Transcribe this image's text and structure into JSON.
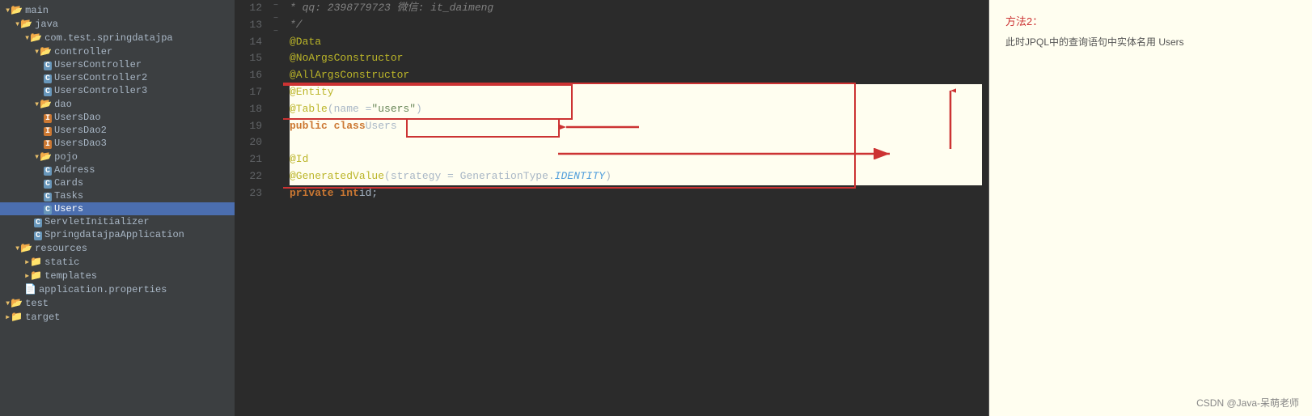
{
  "sidebar": {
    "items": [
      {
        "id": "main",
        "label": "main",
        "level": 0,
        "type": "folder-open",
        "expanded": true
      },
      {
        "id": "java",
        "label": "java",
        "level": 1,
        "type": "folder-open",
        "expanded": true
      },
      {
        "id": "com.test.springdatajpa",
        "label": "com.test.springdatajpa",
        "level": 2,
        "type": "folder-open",
        "expanded": true
      },
      {
        "id": "controller",
        "label": "controller",
        "level": 3,
        "type": "folder-open",
        "expanded": true
      },
      {
        "id": "UsersController",
        "label": "UsersController",
        "level": 4,
        "type": "class"
      },
      {
        "id": "UsersController2",
        "label": "UsersController2",
        "level": 4,
        "type": "class"
      },
      {
        "id": "UsersController3",
        "label": "UsersController3",
        "level": 4,
        "type": "class"
      },
      {
        "id": "dao",
        "label": "dao",
        "level": 3,
        "type": "folder-open",
        "expanded": true
      },
      {
        "id": "UsersDao",
        "label": "UsersDao",
        "level": 4,
        "type": "interface"
      },
      {
        "id": "UsersDao2",
        "label": "UsersDao2",
        "level": 4,
        "type": "interface"
      },
      {
        "id": "UsersDao3",
        "label": "UsersDao3",
        "level": 4,
        "type": "interface"
      },
      {
        "id": "pojo",
        "label": "pojo",
        "level": 3,
        "type": "folder-open",
        "expanded": true
      },
      {
        "id": "Address",
        "label": "Address",
        "level": 4,
        "type": "class"
      },
      {
        "id": "Cards",
        "label": "Cards",
        "level": 4,
        "type": "class"
      },
      {
        "id": "Tasks",
        "label": "Tasks",
        "level": 4,
        "type": "class"
      },
      {
        "id": "Users",
        "label": "Users",
        "level": 4,
        "type": "class",
        "selected": true
      },
      {
        "id": "ServletInitializer",
        "label": "ServletInitializer",
        "level": 3,
        "type": "class"
      },
      {
        "id": "SpringdatajpaApplication",
        "label": "SpringdatajpaApplication",
        "level": 3,
        "type": "class"
      },
      {
        "id": "resources",
        "label": "resources",
        "level": 1,
        "type": "folder-open",
        "expanded": true
      },
      {
        "id": "static",
        "label": "static",
        "level": 2,
        "type": "folder"
      },
      {
        "id": "templates",
        "label": "templates",
        "level": 2,
        "type": "folder"
      },
      {
        "id": "application.properties",
        "label": "application.properties",
        "level": 2,
        "type": "file"
      },
      {
        "id": "test",
        "label": "test",
        "level": 0,
        "type": "folder-open"
      },
      {
        "id": "target",
        "label": "target",
        "level": 0,
        "type": "folder"
      }
    ]
  },
  "code": {
    "lines": [
      {
        "num": 12,
        "fold": "",
        "content_html": "<span class='comment'>* qq: 2398779723 微信: it_daimeng</span>"
      },
      {
        "num": 13,
        "fold": "−",
        "content_html": "<span class='comment'>*/</span>"
      },
      {
        "num": 14,
        "fold": "",
        "content_html": "<span class='annotation'>@Data</span>"
      },
      {
        "num": 15,
        "fold": "",
        "content_html": "<span class='annotation'>@NoArgsConstructor</span>"
      },
      {
        "num": 16,
        "fold": "",
        "content_html": "<span class='annotation'>@AllArgsConstructor</span>"
      },
      {
        "num": 17,
        "fold": "",
        "content_html": "<span class='annotation'>@Entity</span>",
        "highlight": true
      },
      {
        "num": 18,
        "fold": "−",
        "content_html": "<span class='annotation'>@Table</span><span class='normal'>(name = </span><span class='string'>\"users\"</span><span class='normal'>)</span>",
        "highlight": true
      },
      {
        "num": 19,
        "fold": "",
        "content_html": "  <span class='kw'>public class</span> <span class='classname'>Users</span>",
        "highlight": true
      },
      {
        "num": 20,
        "fold": "",
        "content_html": "",
        "highlight": true
      },
      {
        "num": 21,
        "fold": "−",
        "content_html": "    <span class='annotation'>@Id</span>",
        "highlight": true
      },
      {
        "num": 22,
        "fold": "",
        "content_html": "    <span class='annotation'>@GeneratedValue</span><span class='normal'>(strategy = GenerationType.</span><span class='italic-blue'>IDENTITY</span><span class='normal'>)</span>",
        "highlight": true
      },
      {
        "num": 23,
        "fold": "",
        "content_html": "    <span class='kw'>private int</span> id;"
      }
    ]
  },
  "annotation": {
    "title": "方法2：",
    "body": "此时JPQL中的查询语句中实体名用 Users"
  },
  "watermark": "CSDN @Java-呆萌老师"
}
